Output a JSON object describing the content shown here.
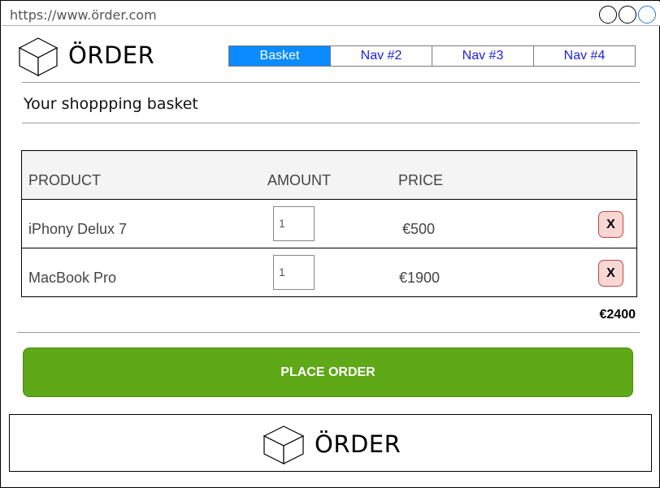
{
  "browser": {
    "url": "https://www.örder.com"
  },
  "header": {
    "brand": "ÖRDER",
    "logo_icon": "cube-icon",
    "nav": [
      {
        "label": "Basket",
        "active": true
      },
      {
        "label": "Nav #2",
        "active": false
      },
      {
        "label": "Nav #3",
        "active": false
      },
      {
        "label": "Nav #4",
        "active": false
      }
    ]
  },
  "page": {
    "title": "Your shoppping basket"
  },
  "table": {
    "columns": [
      "PRODUCT",
      "AMOUNT",
      "PRICE"
    ],
    "rows": [
      {
        "product": "iPhony Delux 7",
        "amount": "1",
        "price": "€500",
        "remove_label": "X"
      },
      {
        "product": "MacBook Pro",
        "amount": "1",
        "price": "€1900",
        "remove_label": "X"
      }
    ],
    "total": "€2400"
  },
  "actions": {
    "place_order_label": "PLACE ORDER"
  },
  "footer": {
    "brand": "ÖRDER",
    "logo_icon": "cube-icon"
  },
  "colors": {
    "active_tab": "#0a8bff",
    "nav_link": "#1f1fe0",
    "place_order": "#5fa817",
    "remove_button_bg": "#f8d7d4",
    "remove_button_border": "#cc4444"
  }
}
